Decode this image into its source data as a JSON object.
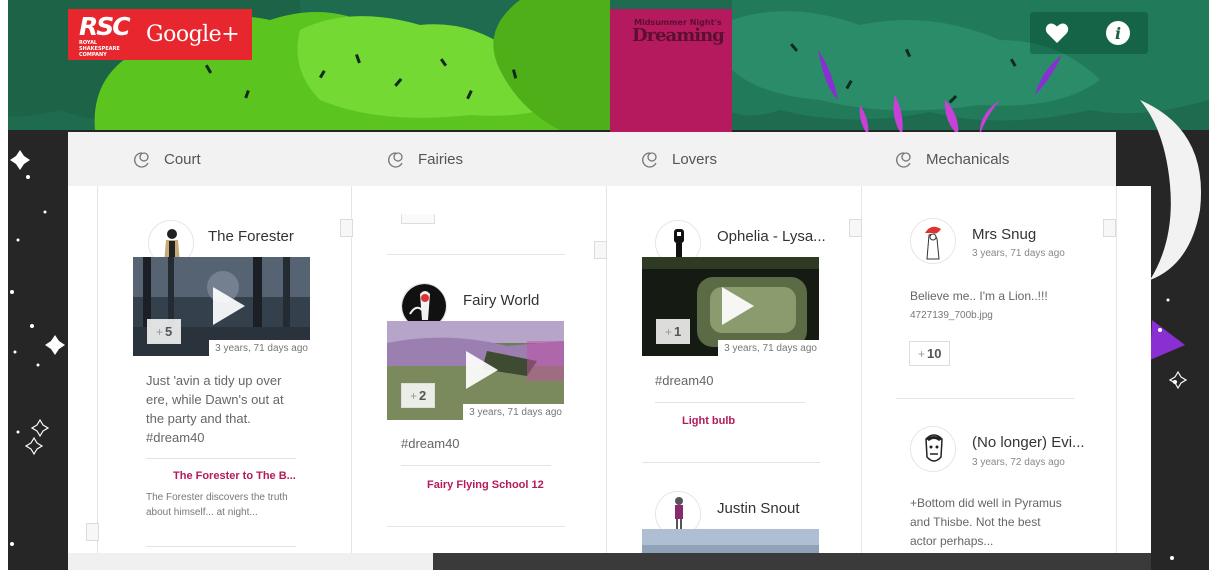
{
  "header": {
    "brand_logo_text": "RSC",
    "brand_logo_sub": "ROYAL SHAKESPEARE COMPANY",
    "brand_service": "Google+",
    "show_title_top": "Midsummer Night's",
    "show_title_main": "Dreaming"
  },
  "tabs": [
    {
      "label": "Court"
    },
    {
      "label": "Fairies"
    },
    {
      "label": "Lovers"
    },
    {
      "label": "Mechanicals"
    }
  ],
  "colors": {
    "brand_red": "#e8262d",
    "show_magenta": "#b5195e",
    "link_magenta": "#b5195e",
    "tab_bar_bg": "#f2f2f2"
  },
  "feed": {
    "court": {
      "author": "The Forester",
      "plus_count": "5",
      "time_ago": "3 years, 71 days ago",
      "body": "Just 'avin a tidy up over ere, while Dawn's out at the party and that. #dream40",
      "link_title": "The Forester to The B...",
      "link_desc": "The Forester discovers the truth about himself... at night..."
    },
    "fairies": {
      "author": "Fairy World",
      "plus_count": "2",
      "time_ago": "3 years, 71 days ago",
      "body": "#dream40",
      "link_title": "Fairy Flying School 12"
    },
    "lovers": [
      {
        "author": "Ophelia - Lysa...",
        "plus_count": "1",
        "time_ago": "3 years, 71 days ago",
        "body": "#dream40",
        "link_title": "Light bulb"
      },
      {
        "author": "Justin Snout"
      }
    ],
    "mechanicals": [
      {
        "author": "Mrs Snug",
        "time_ago": "3 years, 71 days ago",
        "body": "Believe me.. I'm a Lion..!!!",
        "file": "4727139_700b.jpg",
        "plus_count": "10"
      },
      {
        "author": "(No longer) Evi...",
        "time_ago": "3 years, 72 days ago",
        "body": "+Bottom did well in Pyramus and Thisbe. Not the best actor perhaps..."
      }
    ]
  },
  "icons": [
    "heart-icon",
    "info-icon",
    "tab-pin-icon",
    "play-icon"
  ]
}
